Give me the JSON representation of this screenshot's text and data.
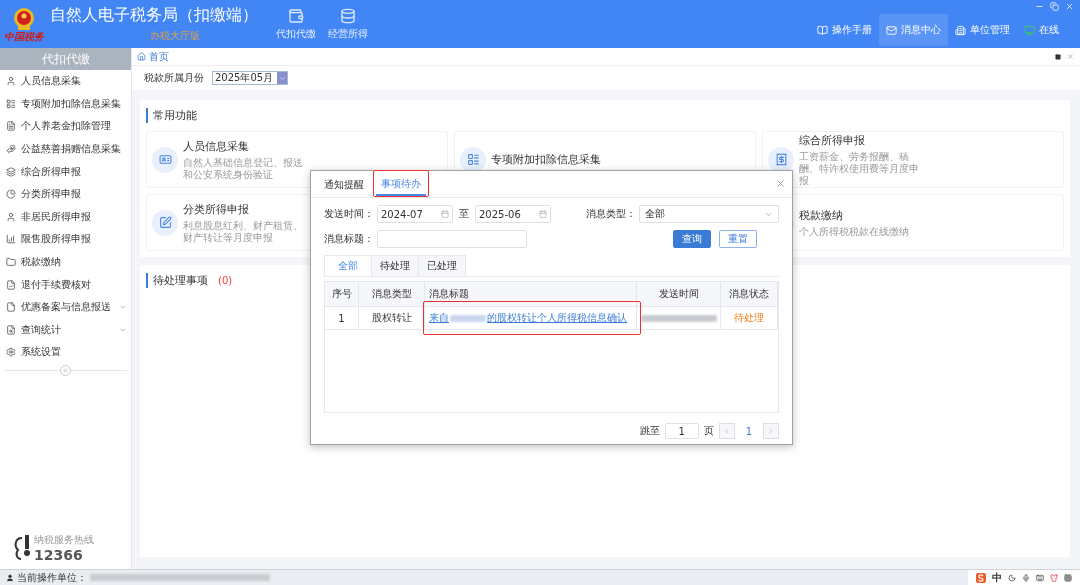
{
  "header": {
    "logo_text": "中国税务",
    "title": "自然人电子税务局（扣缴端）",
    "subtitle": "办税大厅版",
    "tools": [
      {
        "label": "代扣代缴"
      },
      {
        "label": "经营所得"
      }
    ],
    "actions": [
      {
        "label": "操作手册",
        "selected": false
      },
      {
        "label": "消息中心",
        "selected": true
      },
      {
        "label": "单位管理",
        "selected": false
      },
      {
        "label": "在线",
        "selected": false
      }
    ]
  },
  "sidebar": {
    "title": "代扣代缴",
    "items": [
      {
        "label": "人员信息采集",
        "has_submenu": false
      },
      {
        "label": "专项附加扣除信息采集",
        "has_submenu": false
      },
      {
        "label": "个人养老金扣除管理",
        "has_submenu": false
      },
      {
        "label": "公益慈善捐赠信息采集",
        "has_submenu": false
      },
      {
        "label": "综合所得申报",
        "has_submenu": false
      },
      {
        "label": "分类所得申报",
        "has_submenu": false
      },
      {
        "label": "非居民所得申报",
        "has_submenu": false
      },
      {
        "label": "限售股所得申报",
        "has_submenu": false
      },
      {
        "label": "税款缴纳",
        "has_submenu": false
      },
      {
        "label": "退付手续费核对",
        "has_submenu": false
      },
      {
        "label": "优惠备案与信息报送",
        "has_submenu": true
      },
      {
        "label": "查询统计",
        "has_submenu": true
      },
      {
        "label": "系统设置",
        "has_submenu": false
      }
    ],
    "hotline_label": "纳税服务热线",
    "hotline_number": "12366"
  },
  "breadcrumb": "首页",
  "period": {
    "label": "税款所属月份",
    "value": "2025年05月"
  },
  "common": {
    "title": "常用功能",
    "tiles": [
      {
        "title": "人员信息采集",
        "desc": "自然人基础信息登记、报送和公安系统身份验证"
      },
      {
        "title": "专项附加扣除信息采集"
      },
      {
        "title": "综合所得申报",
        "desc": "工资薪金、劳务报酬、稿酬、特许权使用费等月度申报"
      },
      {
        "title": "分类所得申报",
        "desc": "利息股息红利、财产租赁、财产转让等月度申报"
      },
      {
        "title": "税款缴纳",
        "desc": "个人所得税税款在线缴纳"
      }
    ]
  },
  "pending": {
    "title": "待处理事项",
    "count": "(0)"
  },
  "dialog": {
    "tabs": [
      {
        "label": "通知提醒",
        "selected": false
      },
      {
        "label": "事项待办",
        "selected": true
      }
    ],
    "from_label": "发送时间：",
    "from": "2024-07",
    "to_label": "至",
    "to": "2025-06",
    "type_label": "消息类型：",
    "type_value": "全部",
    "title_label": "消息标题：",
    "search_button": "查询",
    "reset_button": "重置",
    "filters": [
      {
        "label": "全部",
        "selected": true
      },
      {
        "label": "待处理",
        "selected": false
      },
      {
        "label": "已处理",
        "selected": false
      }
    ],
    "columns": [
      "序号",
      "消息类型",
      "消息标题",
      "发送时间",
      "消息状态"
    ],
    "rows": [
      {
        "index": "1",
        "type": "股权转让",
        "title_prefix": "来自",
        "title_suffix": "的股权转让个人所得税信息确认",
        "status": "待处理"
      }
    ],
    "jump_label": "跳至",
    "jump_value": "1",
    "page_label": "页",
    "current_page": "1"
  },
  "status_bar": {
    "label": "当前操作单位："
  },
  "tray": {
    "ime": "中"
  }
}
